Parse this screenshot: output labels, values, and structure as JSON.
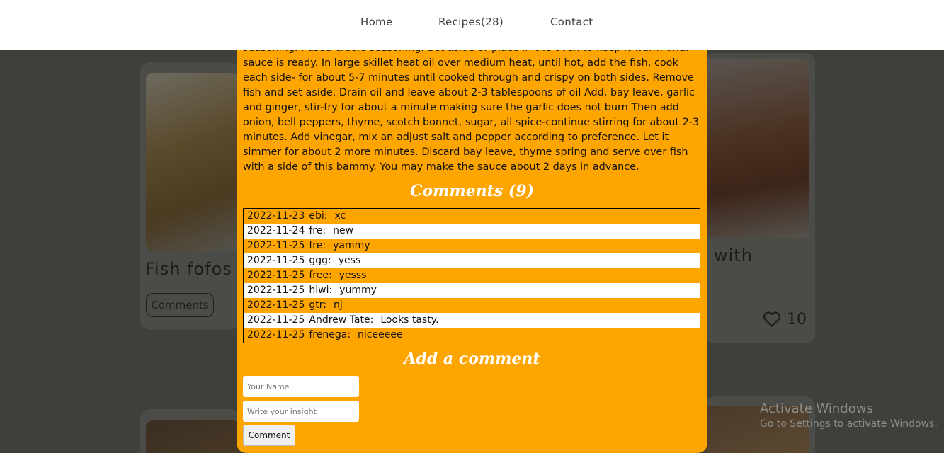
{
  "nav": {
    "home": "Home",
    "recipes": "Recipes(28)",
    "contact": "Contact"
  },
  "background": {
    "card_left_title": "Fish fofos",
    "card_left_button": "Comments",
    "card_right_title_fragment": "with",
    "card_right_likes": "10"
  },
  "modal": {
    "recipe_text": "seasoning. I used creole seasoning. Set aside or place in the oven to keep it warm until sauce is ready. In large skillet heat oil over medium heat, until hot, add the fish, cook each side- for about 5-7 minutes until cooked through and crispy on both sides. Remove fish and set aside. Drain oil and leave about 2-3 tablespoons of oil Add, bay leave, garlic and ginger, stir-fry for about a minute making sure the garlic does not burn Then add onion, bell peppers, thyme, scotch bonnet, sugar, all spice-continue stirring for about 2-3 minutes. Add vinegar, mix an adjust salt and pepper according to preference. Let it simmer for about 2 more minutes. Discard bay leave, thyme spring and serve over fish with a side of this bammy. You may make the sauce about 2 days in advance.",
    "comments_title": "Comments (9)",
    "comments": [
      {
        "date": "2022-11-23",
        "user": "ebi:",
        "text": "xc"
      },
      {
        "date": "2022-11-24",
        "user": "fre:",
        "text": "new"
      },
      {
        "date": "2022-11-25",
        "user": "fre:",
        "text": "yammy"
      },
      {
        "date": "2022-11-25",
        "user": "ggg:",
        "text": "yess"
      },
      {
        "date": "2022-11-25",
        "user": "free:",
        "text": "yesss"
      },
      {
        "date": "2022-11-25",
        "user": "hiwi:",
        "text": "yummy"
      },
      {
        "date": "2022-11-25",
        "user": "gtr:",
        "text": "nj"
      },
      {
        "date": "2022-11-25",
        "user": "Andrew Tate:",
        "text": "Looks tasty."
      },
      {
        "date": "2022-11-25",
        "user": "frenega:",
        "text": "niceeeee"
      }
    ],
    "add_title": "Add a comment",
    "name_placeholder": "Your Name",
    "insight_placeholder": "Write your insight",
    "submit_label": "Comment"
  },
  "watermark": {
    "line1": "Activate Windows",
    "line2": "Go to Settings to activate Windows."
  }
}
